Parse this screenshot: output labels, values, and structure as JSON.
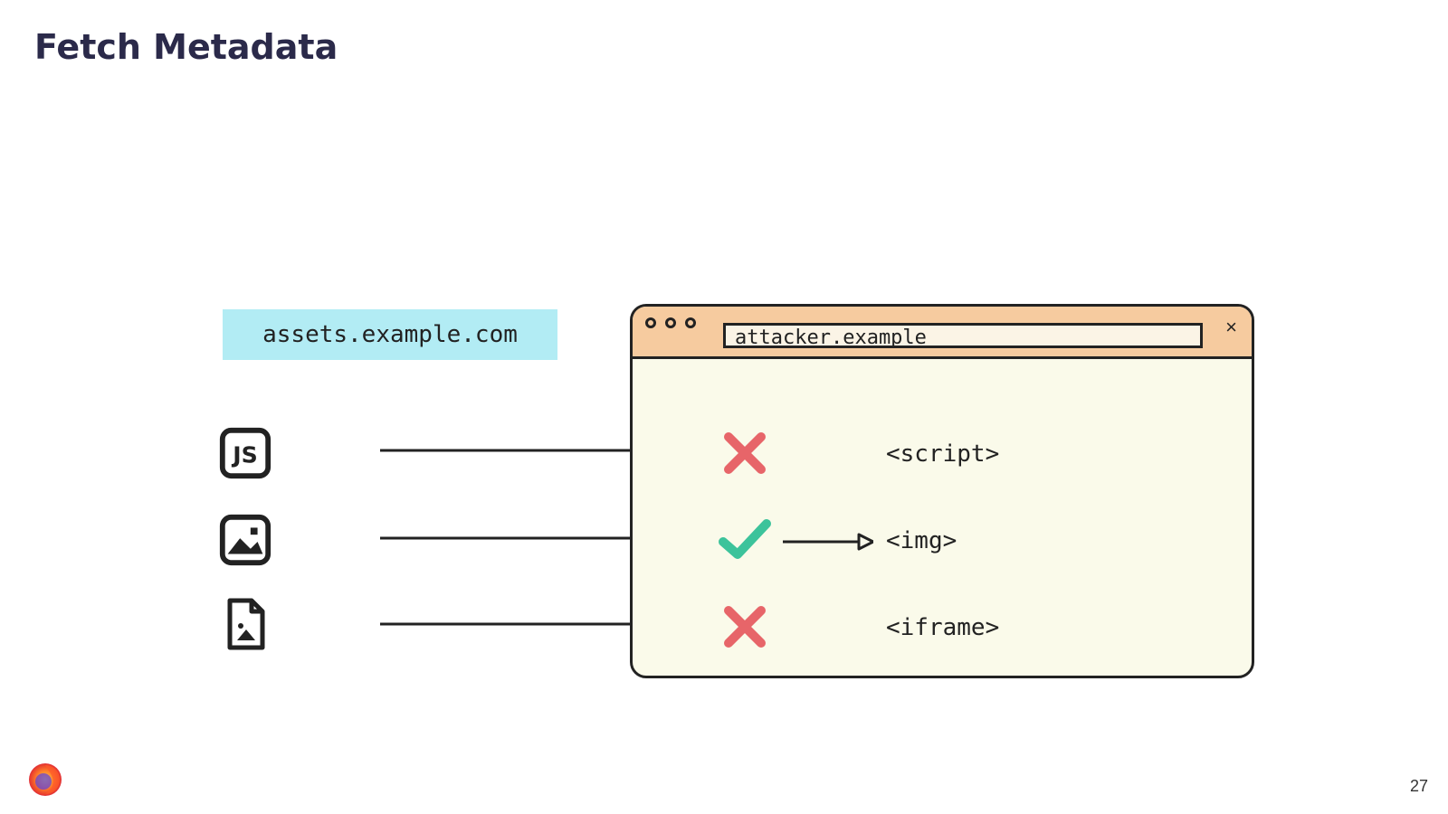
{
  "title": "Fetch Metadata",
  "assets_host": "assets.example.com",
  "attacker_host": "attacker.example",
  "page_number": "27",
  "rows": [
    {
      "label": "<script>",
      "status": "blocked"
    },
    {
      "label": "<img>",
      "status": "allowed"
    },
    {
      "label": "<iframe>",
      "status": "blocked"
    }
  ],
  "colors": {
    "blocked": "#e76569",
    "allowed": "#3cc39b",
    "window_header": "#f6cb9f",
    "window_body": "#fafaea",
    "assets_bg": "#b2ecf4"
  }
}
